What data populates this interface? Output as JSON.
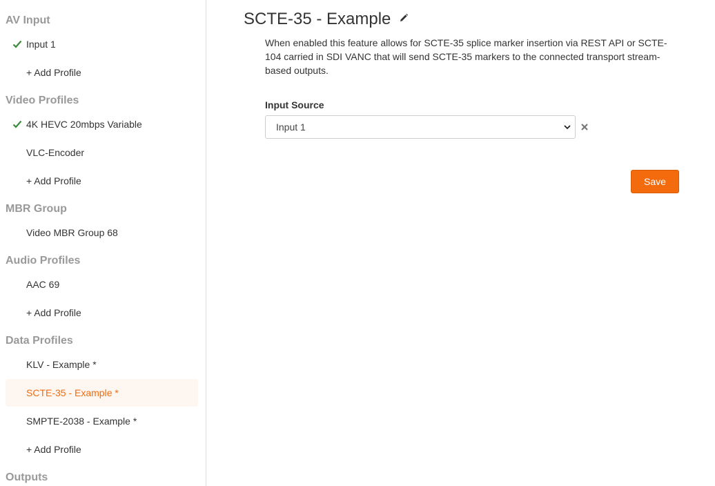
{
  "sidebar": {
    "av_input": {
      "title": "AV Input",
      "items": [
        {
          "label": "Input 1",
          "checked": true
        },
        {
          "label": "+ Add Profile"
        }
      ]
    },
    "video_profiles": {
      "title": "Video Profiles",
      "items": [
        {
          "label": "4K HEVC 20mbps Variable",
          "checked": true
        },
        {
          "label": "VLC-Encoder"
        },
        {
          "label": "+ Add Profile"
        }
      ]
    },
    "mbr_group": {
      "title": "MBR Group",
      "items": [
        {
          "label": "Video MBR Group 68"
        }
      ]
    },
    "audio_profiles": {
      "title": "Audio Profiles",
      "items": [
        {
          "label": "AAC 69"
        },
        {
          "label": "+ Add Profile"
        }
      ]
    },
    "data_profiles": {
      "title": "Data Profiles",
      "items": [
        {
          "label": "KLV - Example *"
        },
        {
          "label": "SCTE-35 - Example *",
          "active": true
        },
        {
          "label": "SMPTE-2038 - Example *"
        },
        {
          "label": "+ Add Profile"
        }
      ]
    },
    "outputs": {
      "title": "Outputs"
    }
  },
  "main": {
    "title": "SCTE-35 - Example",
    "description": "When enabled this feature allows for SCTE-35 splice marker insertion via REST API or SCTE-104 carried in SDI VANC that will send SCTE-35 markers to the connected transport stream-based outputs.",
    "input_source": {
      "label": "Input Source",
      "value": "Input 1"
    },
    "save_label": "Save"
  },
  "colors": {
    "accent": "#f36b0c",
    "check": "#3a8a3a",
    "section_title": "#999999",
    "active_bg": "#fef6f0"
  },
  "icons": {
    "check": "check-icon",
    "edit": "pencil-icon",
    "dropdown": "chevron-down-icon",
    "clear": "close-icon"
  }
}
